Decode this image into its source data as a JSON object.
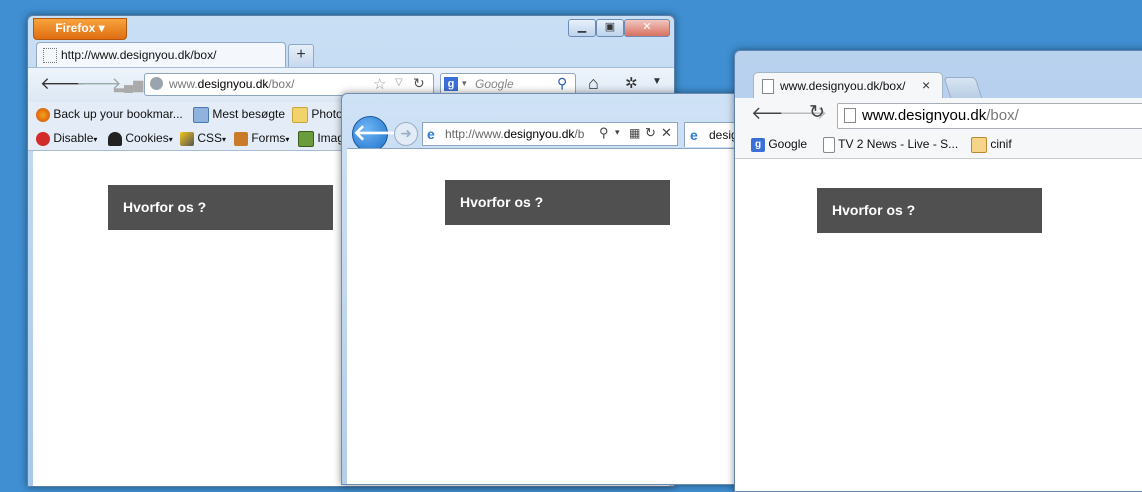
{
  "firefox": {
    "menu_label": "Firefox",
    "tab_title": "http://www.designyou.dk/box/",
    "new_tab": "+",
    "url": {
      "prefix": "www.",
      "domain": "designyou.dk",
      "path": "/box/"
    },
    "search_placeholder": "Google",
    "bookmarks": [
      "Back up your bookmar...",
      "Mest besøgte",
      "Photo"
    ],
    "webdev": [
      "Disable",
      "Cookies",
      "CSS",
      "Forms",
      "Imag"
    ],
    "page_box": "Hvorfor os ?"
  },
  "ie": {
    "url": {
      "prefix": "http://www.",
      "domain": "designyou.dk",
      "path": "/b"
    },
    "tab_title": "desig",
    "page_box": "Hvorfor os ?"
  },
  "chrome": {
    "tab_title": "www.designyou.dk/box/",
    "tab_close": "×",
    "url": {
      "domain": "www.designyou.dk",
      "path": "/box/"
    },
    "bookmarks": [
      "Google",
      "TV 2 News - Live - S...",
      "cinif"
    ],
    "page_box": "Hvorfor os ?"
  },
  "colors": {
    "desktop": "#3f8fd2",
    "box": "#505050",
    "firefox_orange": "#e8801f"
  }
}
